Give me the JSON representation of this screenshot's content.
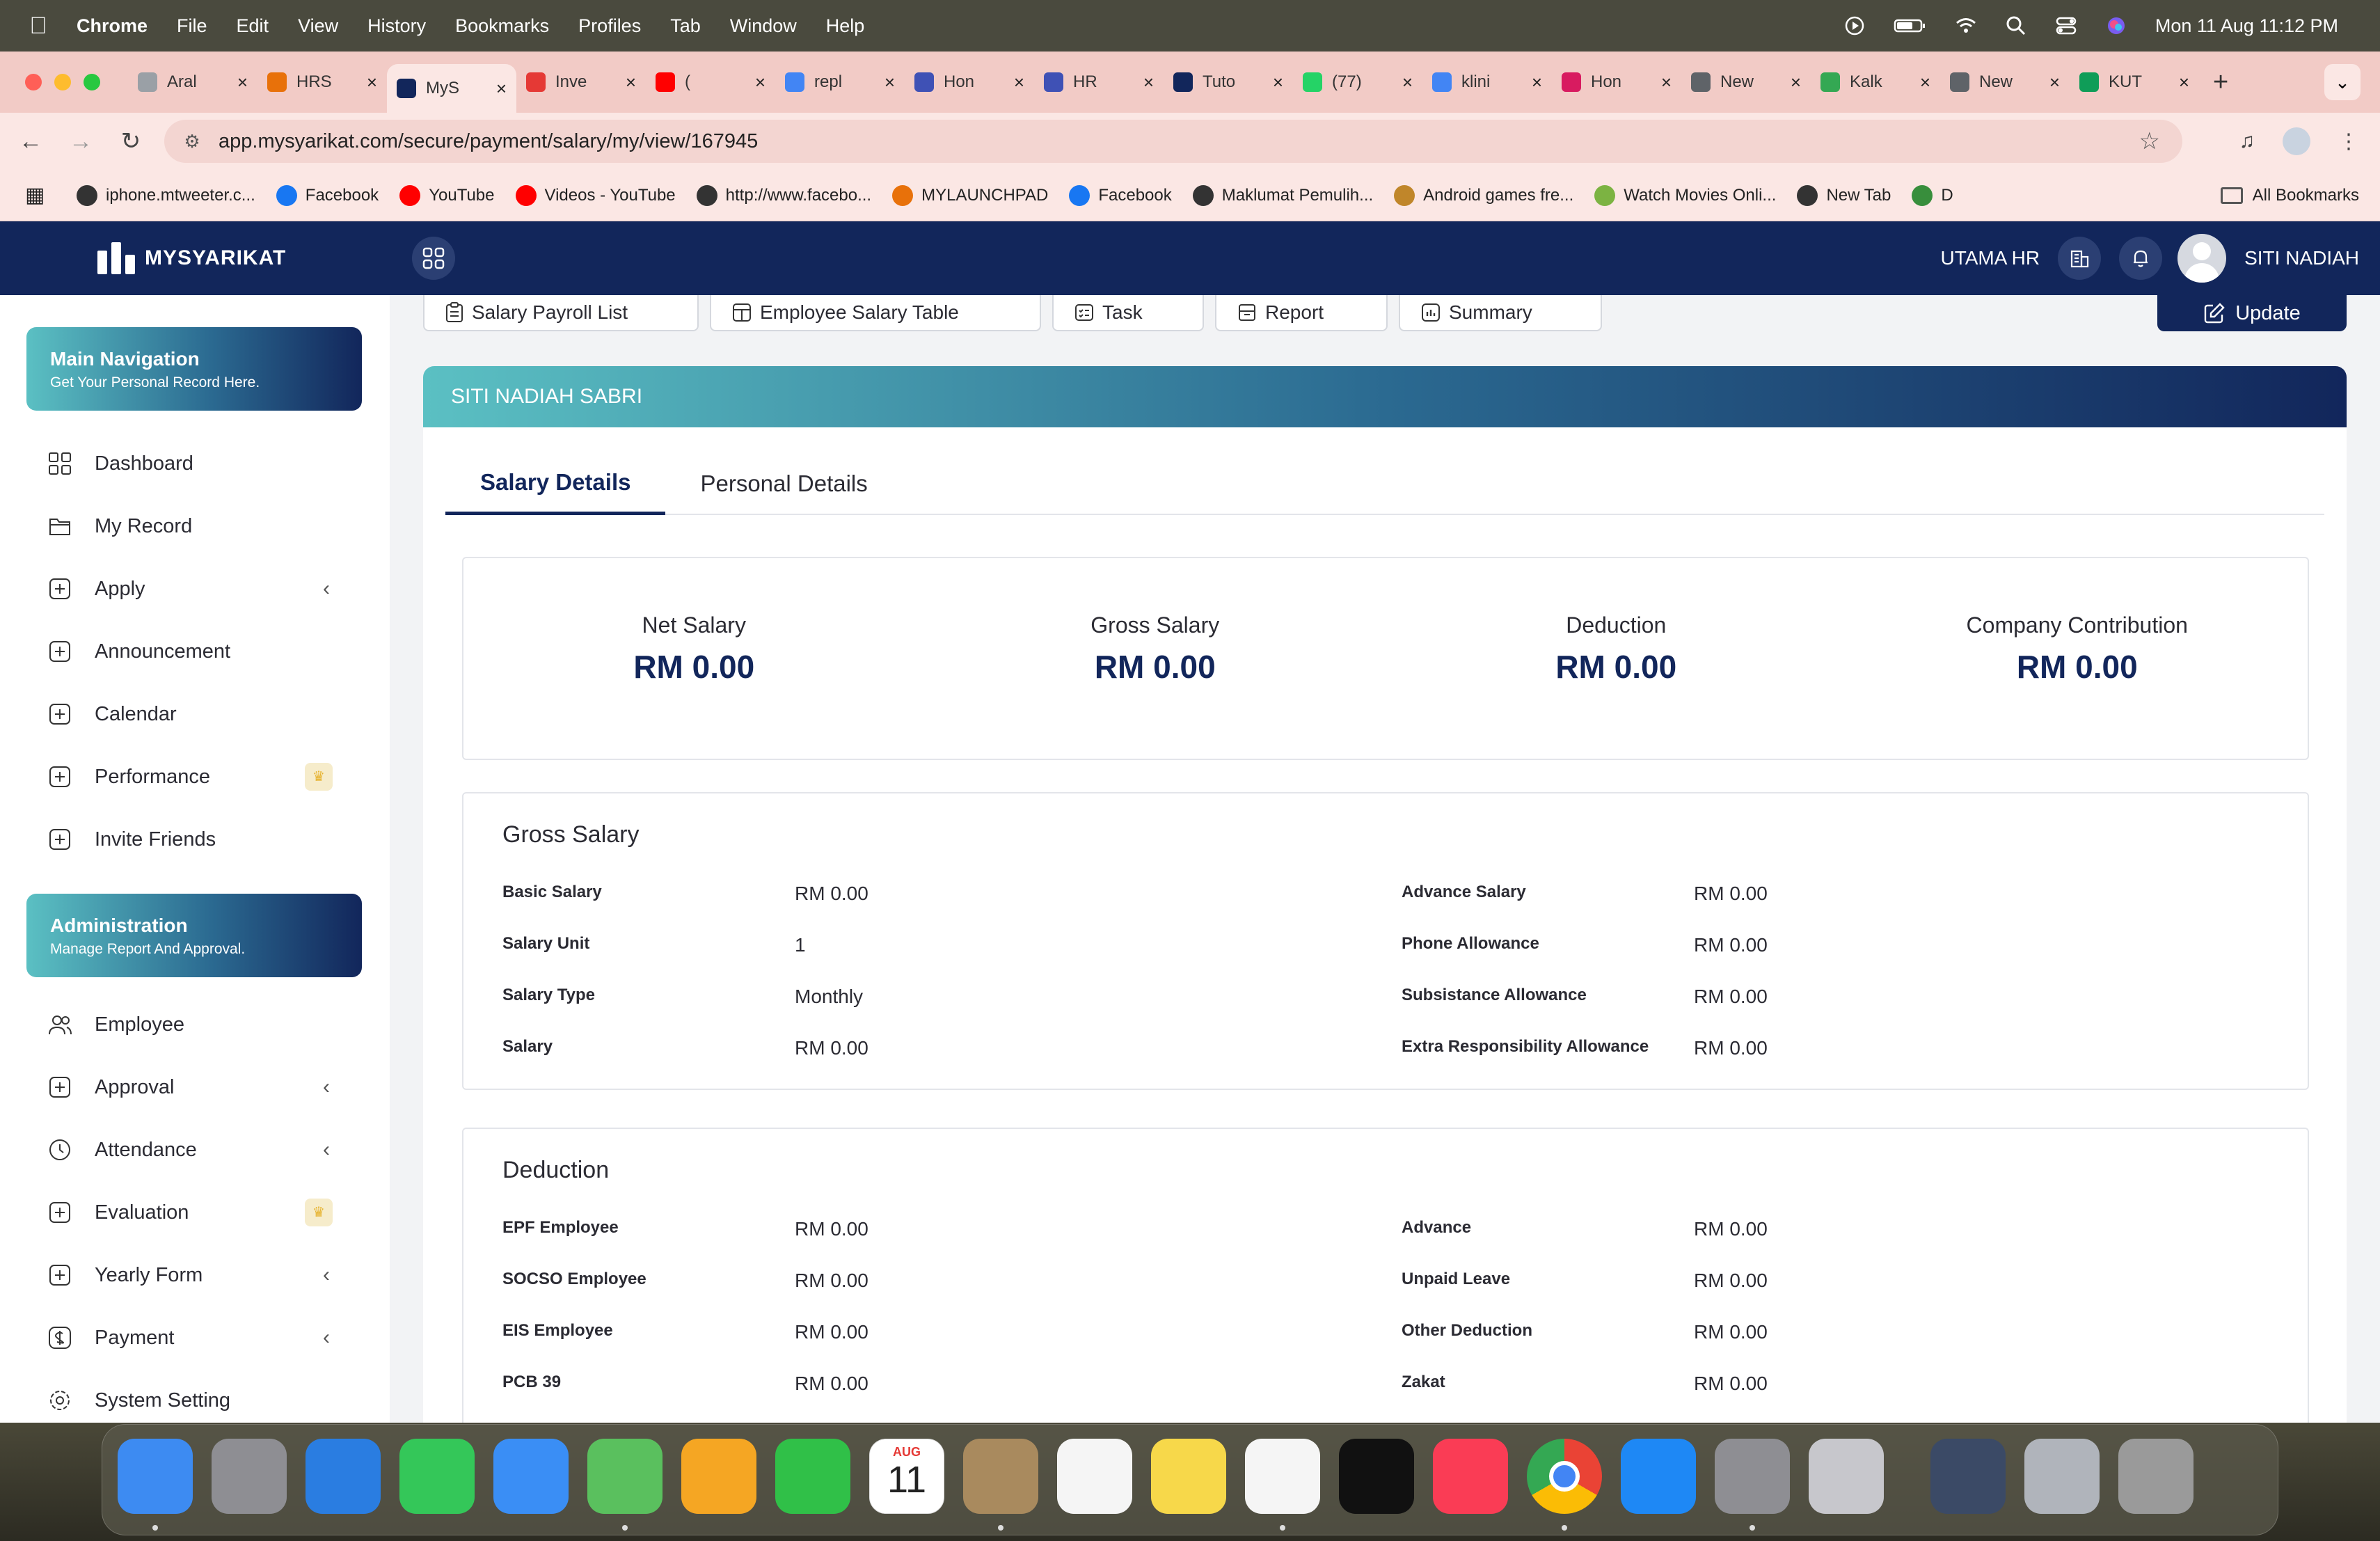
{
  "menubar": {
    "app": "Chrome",
    "items": [
      "File",
      "Edit",
      "View",
      "History",
      "Bookmarks",
      "Profiles",
      "Tab",
      "Window",
      "Help"
    ],
    "datetime": "Mon 11 Aug  11:12 PM"
  },
  "tabs": [
    {
      "title": "Aral",
      "color": "#9aa0a6"
    },
    {
      "title": "HRS",
      "color": "#e8710a"
    },
    {
      "title": "MyS",
      "color": "#12265b",
      "active": true
    },
    {
      "title": "Inve",
      "color": "#e53935"
    },
    {
      "title": "(",
      "color": "#ff0000"
    },
    {
      "title": "repl",
      "color": "#4285f4"
    },
    {
      "title": "Hon",
      "color": "#3f51b5"
    },
    {
      "title": "HR",
      "color": "#3f51b5"
    },
    {
      "title": "Tuto",
      "color": "#12265b"
    },
    {
      "title": "(77)",
      "color": "#25d366"
    },
    {
      "title": "klini",
      "color": "#4285f4"
    },
    {
      "title": "Hon",
      "color": "#d81b60"
    },
    {
      "title": "New",
      "color": "#5f6368"
    },
    {
      "title": "Kalk",
      "color": "#34a853"
    },
    {
      "title": "New",
      "color": "#5f6368"
    },
    {
      "title": "KUT",
      "color": "#0f9d58"
    }
  ],
  "toolbar": {
    "url": "app.mysyarikat.com/secure/payment/salary/my/view/167945"
  },
  "bookmarks": [
    {
      "label": "iphone.mtweeter.c...",
      "color": "#333"
    },
    {
      "label": "Facebook",
      "color": "#1877f2"
    },
    {
      "label": "YouTube",
      "color": "#ff0000"
    },
    {
      "label": "Videos - YouTube",
      "color": "#ff0000"
    },
    {
      "label": "http://www.facebo...",
      "color": "#333"
    },
    {
      "label": "MYLAUNCHPAD",
      "color": "#e8710a"
    },
    {
      "label": "Facebook",
      "color": "#1877f2"
    },
    {
      "label": "Maklumat Pemulih...",
      "color": "#333"
    },
    {
      "label": "Android games fre...",
      "color": "#c0862a"
    },
    {
      "label": "Watch Movies Onli...",
      "color": "#7cb342"
    },
    {
      "label": "New Tab",
      "color": "#333"
    },
    {
      "label": "D",
      "color": "#388e3c"
    }
  ],
  "all_bookmarks": "All Bookmarks",
  "app": {
    "brand": "MYSYARIKAT",
    "company": "UTAMA HR",
    "user": "SITI NADIAH"
  },
  "sidebar": {
    "main_nav": {
      "title": "Main Navigation",
      "subtitle": "Get Your Personal Record Here."
    },
    "main_items": [
      {
        "label": "Dashboard"
      },
      {
        "label": "My Record"
      },
      {
        "label": "Apply",
        "chevron": true
      },
      {
        "label": "Announcement"
      },
      {
        "label": "Calendar"
      },
      {
        "label": "Performance",
        "crown": true
      },
      {
        "label": "Invite Friends"
      }
    ],
    "admin": {
      "title": "Administration",
      "subtitle": "Manage Report And Approval."
    },
    "admin_items": [
      {
        "label": "Employee"
      },
      {
        "label": "Approval",
        "chevron": true
      },
      {
        "label": "Attendance",
        "chevron": true
      },
      {
        "label": "Evaluation",
        "crown": true
      },
      {
        "label": "Yearly Form",
        "chevron": true
      },
      {
        "label": "Payment",
        "chevron": true
      },
      {
        "label": "System Setting"
      }
    ]
  },
  "top_buttons": {
    "payroll": "Salary Payroll List",
    "table": "Employee Salary Table",
    "task": "Task",
    "report": "Report",
    "summary": "Summary",
    "update": "Update"
  },
  "employee_name": "SITI NADIAH SABRI",
  "detail_tabs": {
    "salary": "Salary Details",
    "personal": "Personal Details"
  },
  "summary": [
    {
      "label": "Net Salary",
      "value": "RM 0.00"
    },
    {
      "label": "Gross Salary",
      "value": "RM 0.00"
    },
    {
      "label": "Deduction",
      "value": "RM 0.00"
    },
    {
      "label": "Company Contribution",
      "value": "RM 0.00"
    }
  ],
  "gross": {
    "title": "Gross Salary",
    "left": [
      {
        "k": "Basic Salary",
        "v": "RM 0.00"
      },
      {
        "k": "Salary Unit",
        "v": "1"
      },
      {
        "k": "Salary Type",
        "v": "Monthly"
      },
      {
        "k": "Salary",
        "v": "RM 0.00"
      }
    ],
    "right": [
      {
        "k": "Advance Salary",
        "v": "RM 0.00"
      },
      {
        "k": "Phone Allowance",
        "v": "RM 0.00"
      },
      {
        "k": "Subsistance Allowance",
        "v": "RM 0.00"
      },
      {
        "k": "Extra Responsibility Allowance",
        "v": "RM 0.00"
      }
    ]
  },
  "deduction": {
    "title": "Deduction",
    "left": [
      {
        "k": "EPF Employee",
        "v": "RM 0.00"
      },
      {
        "k": "SOCSO Employee",
        "v": "RM 0.00"
      },
      {
        "k": "EIS Employee",
        "v": "RM 0.00"
      },
      {
        "k": "PCB 39",
        "v": "RM 0.00"
      }
    ],
    "right": [
      {
        "k": "Advance",
        "v": "RM 0.00"
      },
      {
        "k": "Unpaid Leave",
        "v": "RM 0.00"
      },
      {
        "k": "Other Deduction",
        "v": "RM 0.00"
      },
      {
        "k": "Zakat",
        "v": "RM 0.00"
      }
    ]
  },
  "dock": {
    "calendar_month": "AUG",
    "calendar_day": "11",
    "apps": [
      {
        "name": "finder-icon",
        "color": "#3d8bf2"
      },
      {
        "name": "launchpad-icon",
        "color": "#8e8e93"
      },
      {
        "name": "safari-icon",
        "color": "#2a7de1"
      },
      {
        "name": "messages-icon",
        "color": "#34c759"
      },
      {
        "name": "mail-icon",
        "color": "#3a8ef5"
      },
      {
        "name": "maps-icon",
        "color": "#5ac05e"
      },
      {
        "name": "photos-icon",
        "color": "#f5a623"
      },
      {
        "name": "facetime-icon",
        "color": "#30c048"
      },
      {
        "name": "calendar-icon",
        "color": "#ffffff"
      },
      {
        "name": "contacts-icon",
        "color": "#a98a5e"
      },
      {
        "name": "reminders-icon",
        "color": "#f5f5f5"
      },
      {
        "name": "notes-icon",
        "color": "#f7d84a"
      },
      {
        "name": "freeform-icon",
        "color": "#f5f5f5"
      },
      {
        "name": "apple-tv-icon",
        "color": "#111111"
      },
      {
        "name": "music-icon",
        "color": "#fa3c55"
      },
      {
        "name": "chrome-icon",
        "color": "#ea4335"
      },
      {
        "name": "app-store-icon",
        "color": "#1e88f5"
      },
      {
        "name": "system-settings-icon",
        "color": "#8e8e93"
      },
      {
        "name": "iphone-mirroring-icon",
        "color": "#c7c7cc"
      },
      {
        "name": "quicktime-icon",
        "color": "#3b4a66"
      },
      {
        "name": "downloads-stack-icon",
        "color": "#b0b4bb"
      },
      {
        "name": "trash-icon",
        "color": "#9a9a9a"
      }
    ]
  }
}
